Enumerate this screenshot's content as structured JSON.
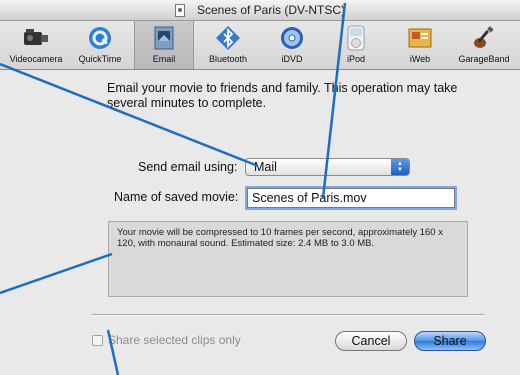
{
  "window": {
    "title": "Scenes of Paris  (DV-NTSC)"
  },
  "toolbar": {
    "items": [
      {
        "label": "Videocamera",
        "icon": "videocamera-icon"
      },
      {
        "label": "QuickTime",
        "icon": "quicktime-icon"
      },
      {
        "label": "Email",
        "icon": "email-icon",
        "selected": true
      },
      {
        "label": "Bluetooth",
        "icon": "bluetooth-icon"
      },
      {
        "label": "iDVD",
        "icon": "idvd-icon"
      },
      {
        "label": "iPod",
        "icon": "ipod-icon"
      },
      {
        "label": "iWeb",
        "icon": "iweb-icon"
      },
      {
        "label": "GarageBand",
        "icon": "garageband-icon"
      }
    ]
  },
  "main": {
    "description": "Email your movie to friends and family. This operation may take several minutes to complete.",
    "send_label": "Send email using:",
    "send_value": "Mail",
    "name_label": "Name of saved movie:",
    "name_value": "Scenes of Paris.mov",
    "info": "Your movie will be compressed to 10 frames per second, approximately 160 x 120, with monaural sound. Estimated size: 2.4 MB to 3.0 MB.",
    "checkbox_label": "Share selected clips only",
    "checkbox_checked": false,
    "checkbox_enabled": false,
    "cancel_label": "Cancel",
    "share_label": "Share"
  },
  "colors": {
    "accent": "#2f78db",
    "annotation_line": "#1a6fc4"
  }
}
